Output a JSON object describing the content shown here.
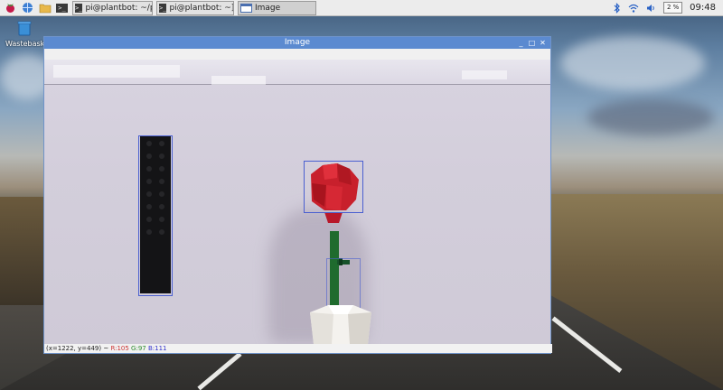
{
  "desktop": {
    "wastebasket_label": "Wastebasket"
  },
  "taskbar": {
    "tasks": [
      {
        "label": "pi@plantbot: ~/plant..."
      },
      {
        "label": "pi@plantbot: ~]"
      },
      {
        "label": "Image"
      }
    ],
    "cpu_label": "2 %",
    "clock": "09:48"
  },
  "window": {
    "title": "Image",
    "status": {
      "coords": "(x=1222, y=449) ~",
      "r": "R:105",
      "g": "G:97",
      "b": "B:111"
    }
  },
  "colors": {
    "titlebar": "#5b8ad0",
    "bbox": "#4a5fd0",
    "rose_red": "#c8202c",
    "stem_green": "#1f6b2e"
  }
}
